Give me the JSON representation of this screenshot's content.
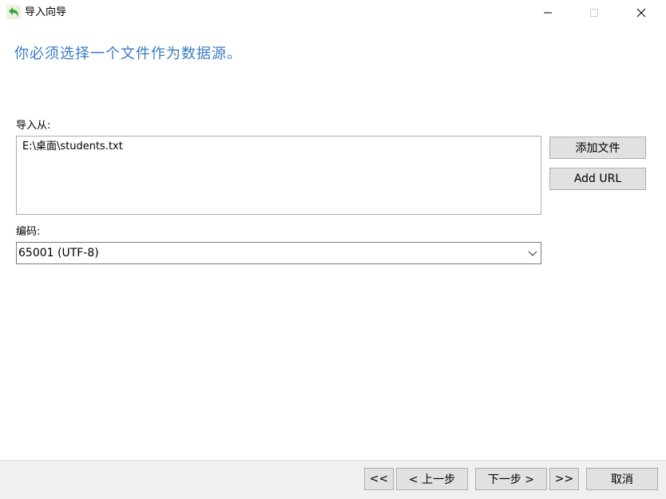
{
  "window": {
    "title": "导入向导",
    "icon": "import-arrow-icon",
    "controls": {
      "minimize_icon": "minimize-icon",
      "maximize_icon": "maximize-icon",
      "close_icon": "close-icon"
    }
  },
  "heading": "你必须选择一个文件作为数据源。",
  "import_from": {
    "label": "导入从:",
    "files": [
      "E:\\桌面\\students.txt"
    ]
  },
  "side_buttons": {
    "add_file": "添加文件",
    "add_url": "Add URL"
  },
  "encoding": {
    "label": "编码:",
    "selected": "65001 (UTF-8)"
  },
  "footer": {
    "first": "<<",
    "prev": "< 上一步",
    "next": "下一步 >",
    "last": ">>",
    "cancel": "取消"
  },
  "colors": {
    "heading": "#3a7cc4",
    "button_bg": "#e1e1e1",
    "footer_bg": "#f0f0f0",
    "icon_green": "#3aa63a"
  }
}
